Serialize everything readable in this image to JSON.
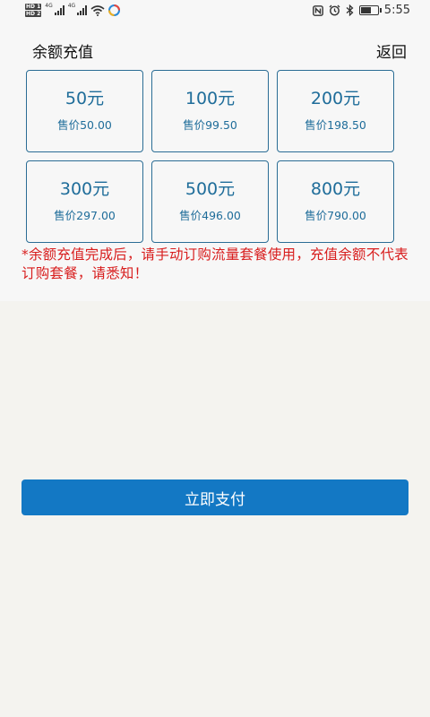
{
  "status_bar": {
    "time": "5:55",
    "sim1": "HD 1",
    "sim2": "HD 2",
    "network": "4G",
    "icons": [
      "nfc-icon",
      "alarm-icon",
      "bluetooth-icon",
      "battery-icon",
      "wifi-icon",
      "app-notification-icon"
    ]
  },
  "header": {
    "title": "余额充值",
    "back_label": "返回"
  },
  "options": [
    {
      "amount": "50元",
      "price": "售价50.00"
    },
    {
      "amount": "100元",
      "price": "售价99.50"
    },
    {
      "amount": "200元",
      "price": "售价198.50"
    },
    {
      "amount": "300元",
      "price": "售价297.00"
    },
    {
      "amount": "500元",
      "price": "售价496.00"
    },
    {
      "amount": "800元",
      "price": "售价790.00"
    }
  ],
  "notice": "*余额充值完成后，请手动订购流量套餐使用，充值余额不代表订购套餐，请悉知！",
  "pay_button": {
    "label": "立即支付"
  },
  "colors": {
    "accent": "#1378c4",
    "card_text": "#1f6d9a",
    "card_border": "#2b6d95",
    "notice": "#d81e1e"
  }
}
